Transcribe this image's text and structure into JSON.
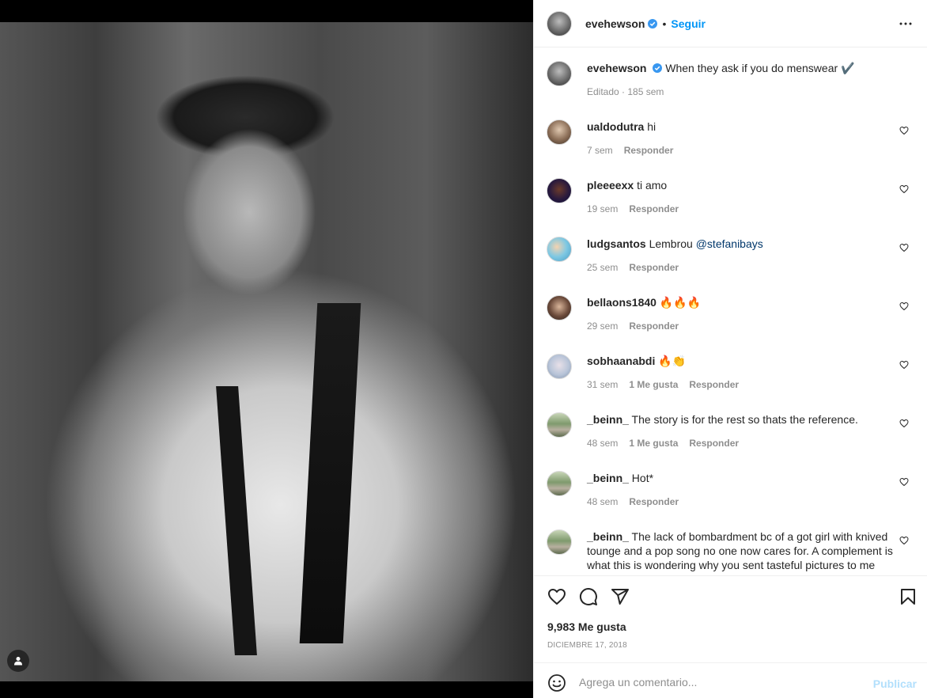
{
  "post": {
    "username": "evehewson",
    "follow_label": "Seguir",
    "dot": "•"
  },
  "caption": {
    "username": "evehewson",
    "text": "When they ask if you do menswear ✔️",
    "edited": "Editado",
    "age": "185 sem"
  },
  "comments": [
    {
      "username": "ualdodutra",
      "text": "hi",
      "age": "7 sem",
      "likes": "",
      "reply": "Responder"
    },
    {
      "username": "pleeeexx",
      "text": "ti amo",
      "age": "19 sem",
      "likes": "",
      "reply": "Responder"
    },
    {
      "username": "ludgsantos",
      "text": "Lembrou ",
      "mention": "@stefanibays",
      "age": "25 sem",
      "likes": "",
      "reply": "Responder"
    },
    {
      "username": "bellaons1840",
      "text": "🔥🔥🔥",
      "age": "29 sem",
      "likes": "",
      "reply": "Responder"
    },
    {
      "username": "sobhaanabdi",
      "text": "🔥👏",
      "age": "31 sem",
      "likes": "1 Me gusta",
      "reply": "Responder"
    },
    {
      "username": "_beinn_",
      "text": "The story is for the rest so thats the reference.",
      "age": "48 sem",
      "likes": "1 Me gusta",
      "reply": "Responder"
    },
    {
      "username": "_beinn_",
      "text": "Hot*",
      "age": "48 sem",
      "likes": "",
      "reply": "Responder"
    },
    {
      "username": "_beinn_",
      "text": "The lack of bombardment bc of a got girl with knived tounge and a pop song no one now cares for. A complement is what this is wondering why you sent tasteful pictures to me",
      "age": "",
      "likes": "",
      "reply": ""
    }
  ],
  "stats": {
    "likes": "9,983 Me gusta",
    "date": "DICIEMBRE 17, 2018"
  },
  "composer": {
    "placeholder": "Agrega un comentario...",
    "post_label": "Publicar"
  },
  "icons": {
    "verified": "verified-badge-icon",
    "more": "more-options-icon",
    "like": "heart-icon",
    "comment": "comment-icon",
    "share": "share-icon",
    "save": "bookmark-icon",
    "emoji": "emoji-icon",
    "user_tag": "user-tag-icon"
  },
  "colors": {
    "accent": "#0095f6",
    "verified": "#3897f0",
    "muted": "#8e8e8e",
    "post_disabled": "#b2dffc"
  }
}
